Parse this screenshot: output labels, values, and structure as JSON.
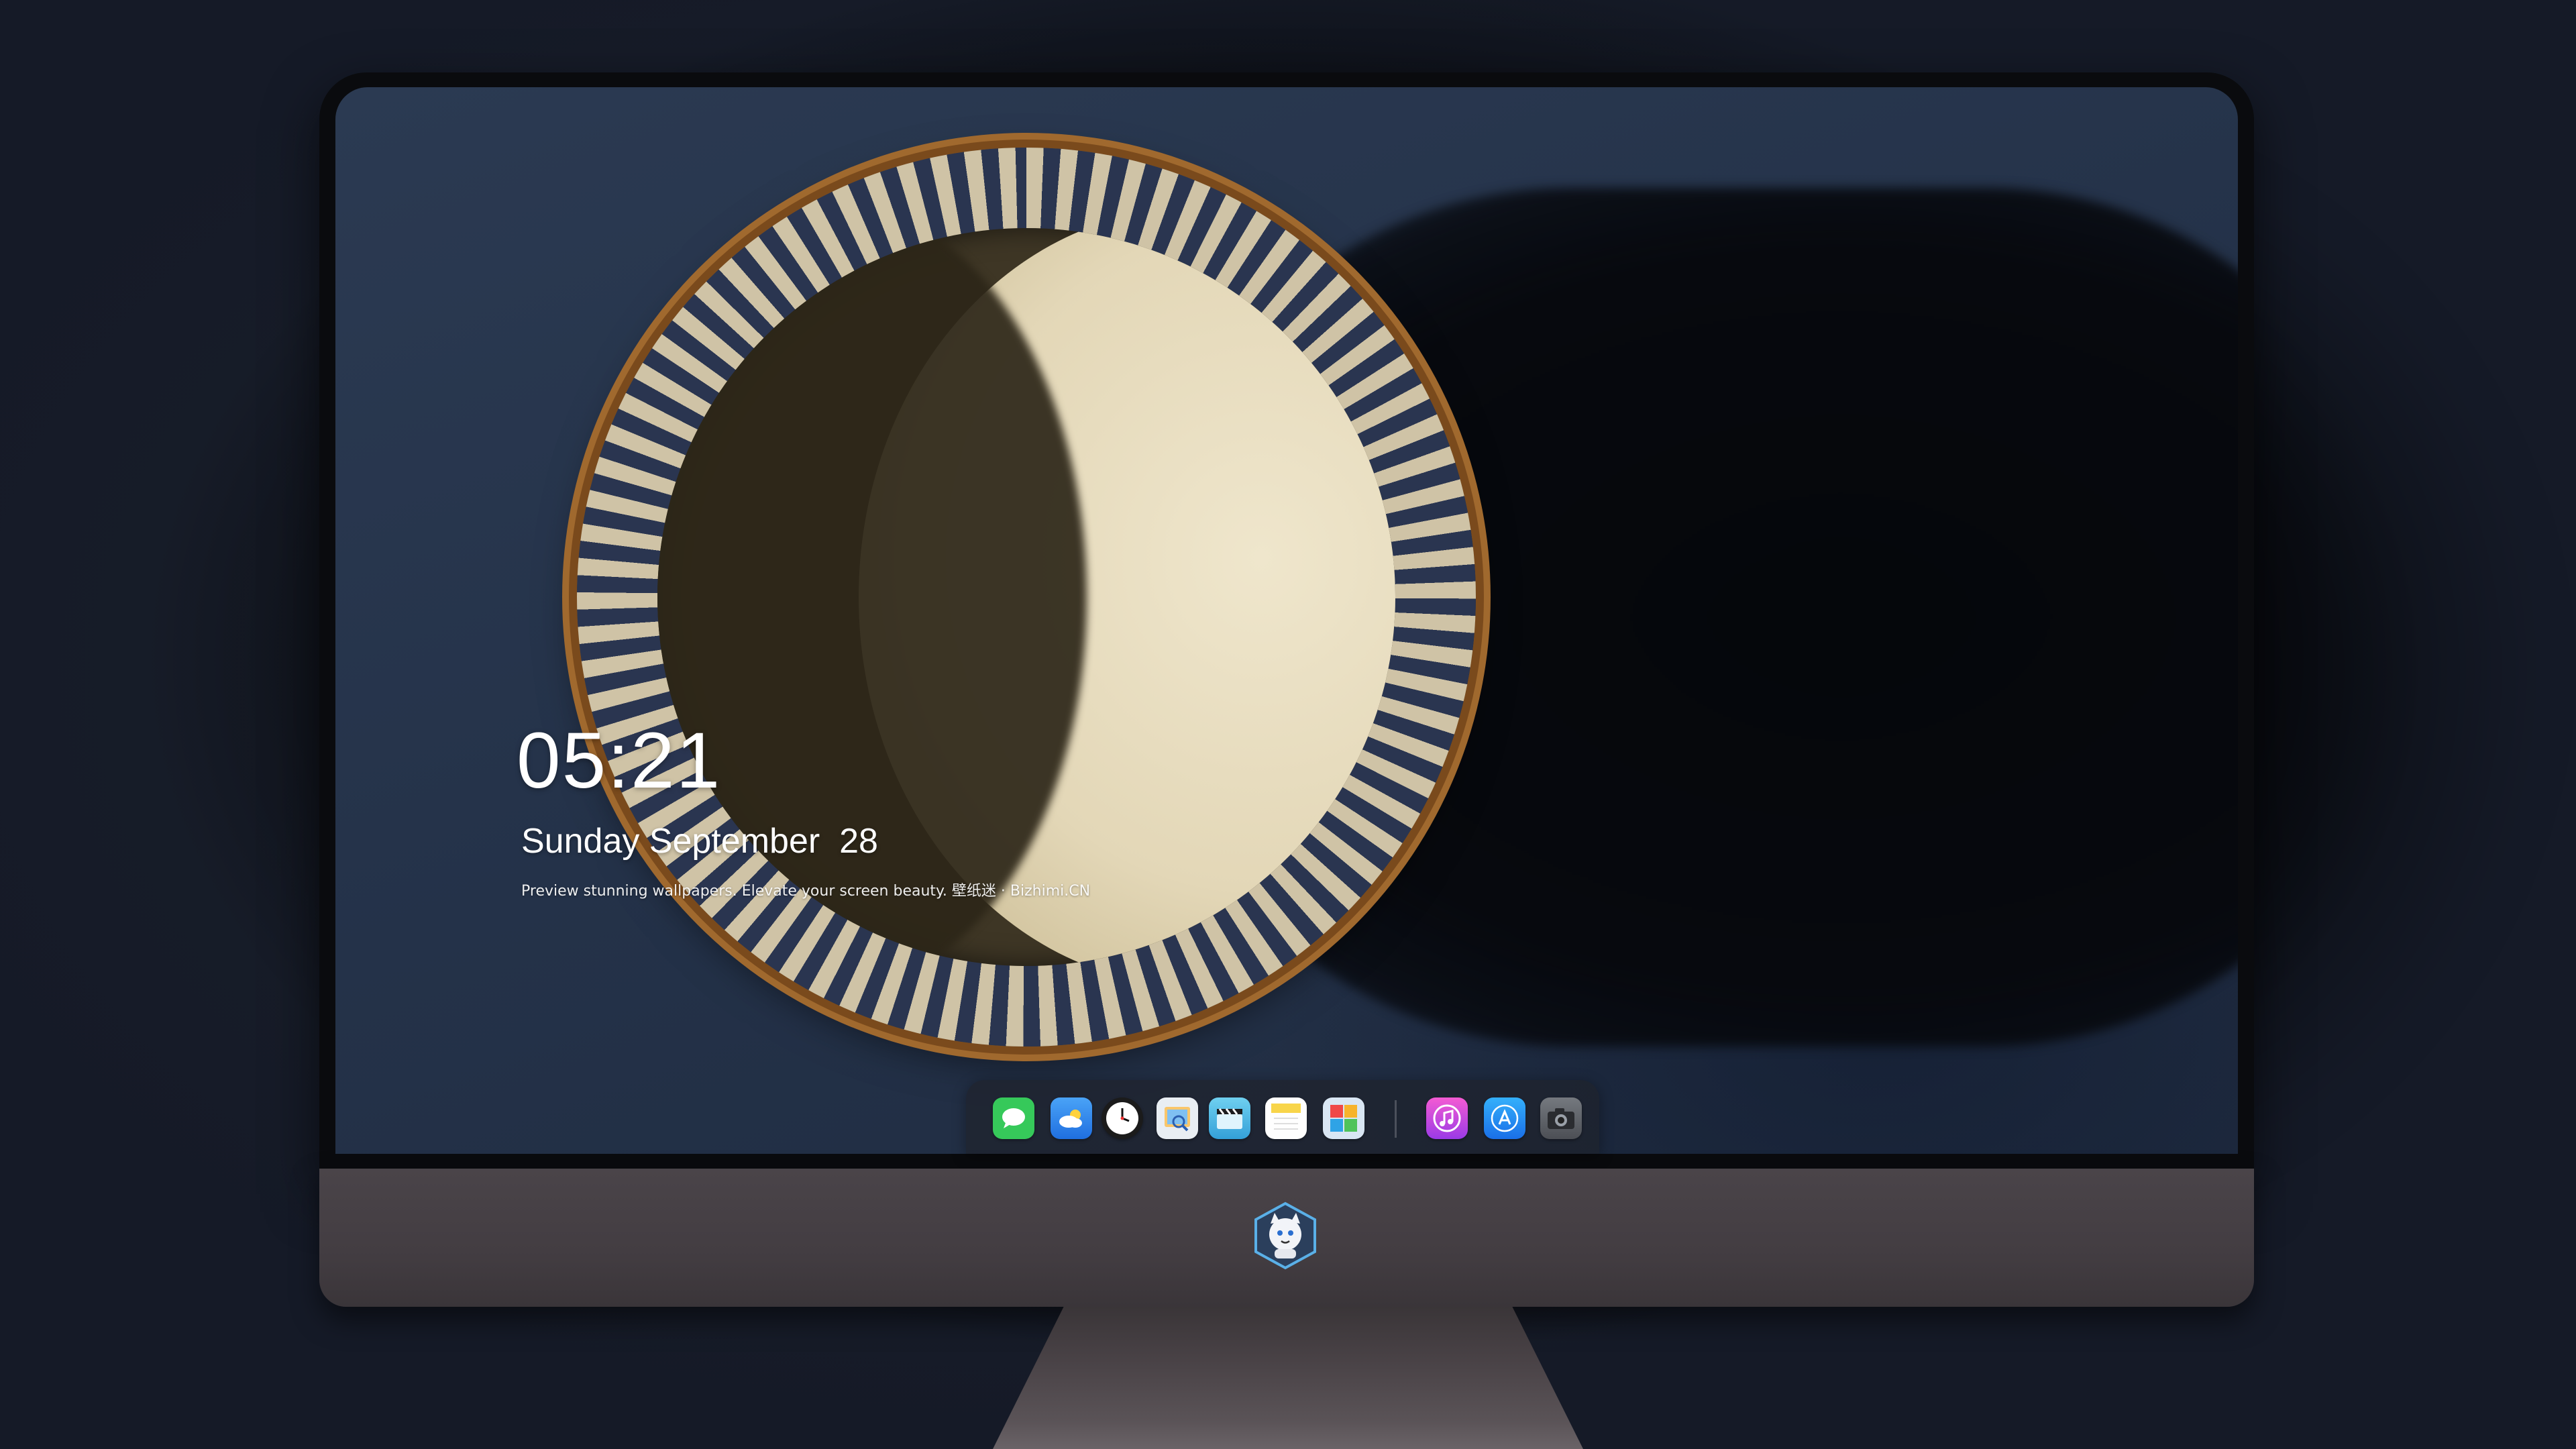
{
  "lockscreen": {
    "time": "05:21",
    "date": "Sunday September  28",
    "tagline": "Preview stunning wallpapers. Elevate your screen beauty. 壁纸迷 · Bizhimi.CN"
  },
  "dock": {
    "items": [
      {
        "name": "messages",
        "icon": "speech-bubble-icon",
        "color": "#36c95a"
      },
      {
        "name": "weather",
        "icon": "cloud-icon",
        "color": "#2f8cf0"
      },
      {
        "name": "clock",
        "icon": "clock-icon",
        "color": "#1b1b1b"
      },
      {
        "name": "preview",
        "icon": "photo-viewer-icon",
        "color": "#e9eef3"
      },
      {
        "name": "clips",
        "icon": "clapper-icon",
        "color": "#4fb8e3"
      },
      {
        "name": "notes",
        "icon": "notepad-icon",
        "color": "#f8d54a"
      },
      {
        "name": "photo-booth",
        "icon": "photos-icon",
        "color": "#d9e6f3"
      },
      {
        "name": "itunes",
        "icon": "music-note-icon",
        "color": "#c83ad8"
      },
      {
        "name": "app-store",
        "icon": "app-store-icon",
        "color": "#1c8ef5"
      },
      {
        "name": "camera",
        "icon": "camera-icon",
        "color": "#5a5d63"
      }
    ]
  },
  "colors": {
    "bezel": "#0a0b0e",
    "chin": "#463f44",
    "wallpaper_bg": "#253349",
    "milk": "#e8dec3"
  }
}
